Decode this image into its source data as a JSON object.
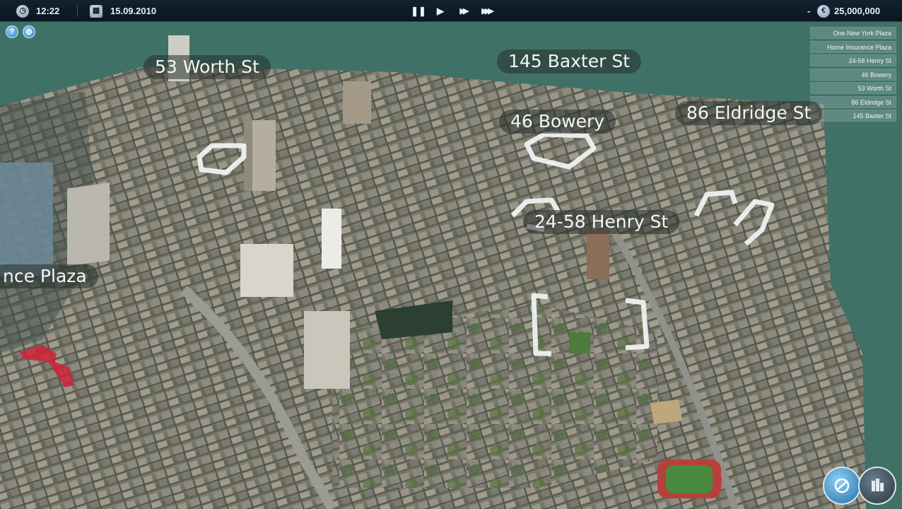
{
  "topbar": {
    "time": "12:22",
    "date": "15.09.2010",
    "money": "25,000,000",
    "currency_symbol": "€",
    "money_prefix": "-",
    "controls": {
      "pause": "❚❚",
      "play": "▶",
      "fast": "▶▶",
      "faster": "▶▶▶"
    },
    "icons": {
      "clock": "clock-icon",
      "calendar": "calendar-icon",
      "currency": "euro-icon"
    }
  },
  "buttons": {
    "help": "?",
    "settings": "⚙"
  },
  "building_list": [
    "One New York Plaza",
    "Home Insurance Plaza",
    "24-58 Henry St",
    "46 Bowery",
    "53 Worth St",
    "86 Eldridge St",
    "145 Baxter St"
  ],
  "map_labels": {
    "worth": "53 Worth St",
    "baxter": "145 Baxter St",
    "bowery": "46 Bowery",
    "eldridge": "86 Eldridge St",
    "henry": "24-58 Henry St",
    "plaza": "nce Plaza"
  },
  "colors": {
    "water": "#3d7068",
    "topbar": "#0f1b26",
    "highlight_selected": "#d0223a",
    "highlight": "#f2f4f5"
  }
}
